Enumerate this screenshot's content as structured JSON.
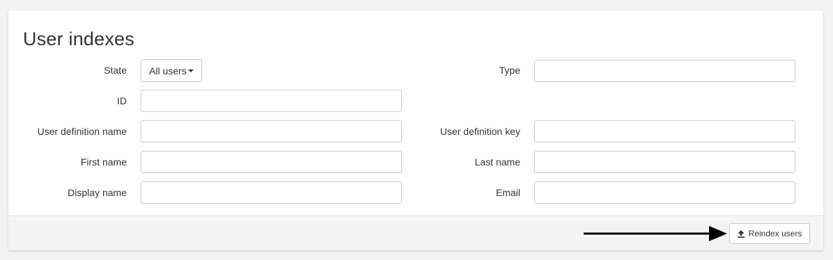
{
  "card": {
    "title": "User indexes"
  },
  "form": {
    "state_label": "State",
    "state_value": "All users",
    "type_label": "Type",
    "type_value": "",
    "id_label": "ID",
    "id_value": "",
    "user_definition_name_label": "User definition name",
    "user_definition_name_value": "",
    "user_definition_key_label": "User definition key",
    "user_definition_key_value": "",
    "first_name_label": "First name",
    "first_name_value": "",
    "last_name_label": "Last name",
    "last_name_value": "",
    "display_name_label": "Display name",
    "display_name_value": "",
    "email_label": "Email",
    "email_value": ""
  },
  "footer": {
    "reindex_label": "Reindex users",
    "reindex_icon": "upload-icon",
    "arrow_icon": "arrow-right-icon"
  }
}
